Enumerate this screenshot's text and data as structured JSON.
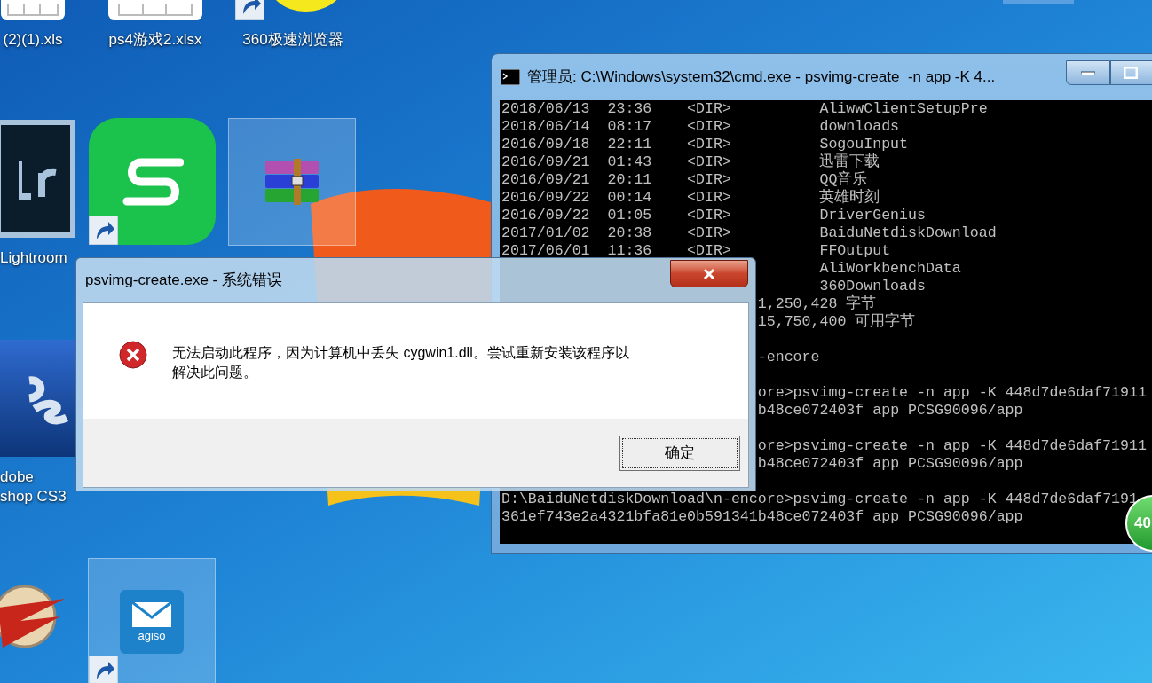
{
  "desktop_icons": [
    {
      "kind": "spreadsheet",
      "label_lines": [
        "(2)(1).xls"
      ],
      "shortcut": false,
      "selected": false
    },
    {
      "kind": "spreadsheet",
      "label_lines": [
        "ps4游戏2.xlsx"
      ],
      "shortcut": false,
      "selected": false
    },
    {
      "kind": "browser",
      "label_lines": [
        "360极速浏览器"
      ],
      "shortcut": true,
      "selected": false
    },
    {
      "kind": "lightroom",
      "label_lines": [
        "Lightroom"
      ],
      "shortcut": false,
      "selected": false
    },
    {
      "kind": "wps",
      "shortcut": true,
      "selected": false
    },
    {
      "kind": "archive",
      "shortcut": false,
      "selected": true
    },
    {
      "kind": "photoshop",
      "label_lines": [
        "dobe",
        "shop CS3"
      ],
      "shortcut": false,
      "selected": false
    },
    {
      "kind": "game",
      "shortcut": false,
      "selected": false
    },
    {
      "kind": "mail",
      "badge_text": "agiso",
      "shortcut": true,
      "selected": true
    }
  ],
  "cmd_window": {
    "title": "管理员: C:\\Windows\\system32\\cmd.exe - psvimg-create  -n app -K 4...",
    "lines": [
      {
        "kind": "dir",
        "date": "2018/06/13",
        "time": "23:36",
        "type": "<DIR>",
        "name": "AliwwClientSetupPre"
      },
      {
        "kind": "dir",
        "date": "2018/06/14",
        "time": "08:17",
        "type": "<DIR>",
        "name": "downloads"
      },
      {
        "kind": "dir",
        "date": "2016/09/18",
        "time": "22:11",
        "type": "<DIR>",
        "name": "SogouInput"
      },
      {
        "kind": "dir",
        "date": "2016/09/21",
        "time": "01:43",
        "type": "<DIR>",
        "name": "迅雷下载"
      },
      {
        "kind": "dir",
        "date": "2016/09/21",
        "time": "20:11",
        "type": "<DIR>",
        "name": "QQ音乐"
      },
      {
        "kind": "dir",
        "date": "2016/09/22",
        "time": "00:14",
        "type": "<DIR>",
        "name": "英雄时刻"
      },
      {
        "kind": "dir",
        "date": "2016/09/22",
        "time": "01:05",
        "type": "<DIR>",
        "name": "DriverGenius"
      },
      {
        "kind": "dir",
        "date": "2017/01/02",
        "time": "20:38",
        "type": "<DIR>",
        "name": "BaiduNetdiskDownload"
      },
      {
        "kind": "dir",
        "date": "2017/06/01",
        "time": "11:36",
        "type": "<DIR>",
        "name": "FFOutput"
      },
      {
        "kind": "dir",
        "name": "AliWorkbenchData"
      },
      {
        "kind": "dir",
        "name": "360Downloads"
      },
      {
        "kind": "partial",
        "text": "1,250,428 字节"
      },
      {
        "kind": "partial",
        "text": "15,750,400 可用字节"
      },
      {
        "kind": "blank"
      },
      {
        "kind": "partial",
        "text": "-encore"
      },
      {
        "kind": "blank"
      },
      {
        "kind": "partial",
        "text": "ore>psvimg-create -n app -K 448d7de6daf71911"
      },
      {
        "kind": "partial",
        "text": "b48ce072403f app PCSG90096/app"
      },
      {
        "kind": "blank"
      },
      {
        "kind": "partial",
        "text": "ore>psvimg-create -n app -K 448d7de6daf71911"
      },
      {
        "kind": "partial",
        "text": "b48ce072403f app PCSG90096/app"
      },
      {
        "kind": "blank"
      },
      {
        "kind": "full",
        "text": "D:\\BaiduNetdiskDownload\\n-encore>psvimg-create -n app -K 448d7de6daf7191"
      },
      {
        "kind": "full",
        "text": "361ef743e2a4321bfa81e0b591341b48ce072403f app PCSG90096/app"
      }
    ]
  },
  "error_dialog": {
    "title": "psvimg-create.exe - 系统错误",
    "message": "无法启动此程序，因为计算机中丢失 cygwin1.dll。尝试重新安装该程序以解决此问题。",
    "button": "确定"
  },
  "floating_badge": {
    "text": "40"
  }
}
